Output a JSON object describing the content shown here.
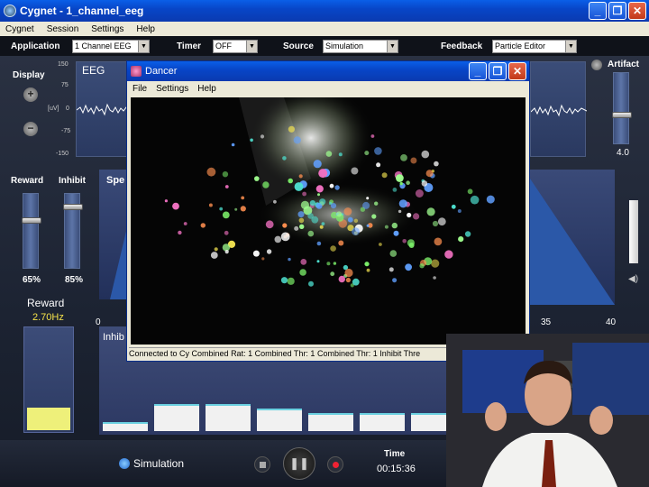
{
  "window": {
    "title": "Cygnet  -  1_channel_eeg",
    "min": "_",
    "max": "❐",
    "close": "✕"
  },
  "menu": [
    "Cygnet",
    "Session",
    "Settings",
    "Help"
  ],
  "controls": {
    "application_label": "Application",
    "application_value": "1 Channel EEG",
    "timer_label": "Timer",
    "timer_value": "OFF",
    "source_label": "Source",
    "source_value": "Simulation",
    "feedback_label": "Feedback",
    "feedback_value": "Particle Editor"
  },
  "left": {
    "display_label": "Display",
    "plus": "+",
    "minus": "−",
    "eeg_label": "EEG",
    "eeg_ticks": [
      "150",
      "75",
      "0",
      "-75",
      "-150"
    ],
    "eeg_unit": "[uV]",
    "reward_label": "Reward",
    "inhibit_label": "Inhibit",
    "reward_pct": "65%",
    "inhibit_pct": "85%",
    "reward_level": 0.65,
    "inhibit_level": 0.85,
    "reward_freq_label": "Reward",
    "reward_freq": "2.70Hz",
    "reward_bar_level": 0.22,
    "spectrum_label": "Spe",
    "inhibit_section_label": "Inhib"
  },
  "right": {
    "artifact_label": "Artifact",
    "artifact_value": "4.0",
    "artifact_level": 0.4,
    "axis_ticks": [
      "35",
      "40"
    ],
    "axis_zero": "0"
  },
  "dancer": {
    "title": "Dancer",
    "menu": [
      "File",
      "Settings",
      "Help"
    ],
    "status": "Connected to Cy Combined Rat: 1 Combined Thr: 1 Combined Thr: 1 Inhibit Thre"
  },
  "bottom": {
    "source": "Simulation",
    "time_label": "Time",
    "time_value": "00:15:36"
  }
}
